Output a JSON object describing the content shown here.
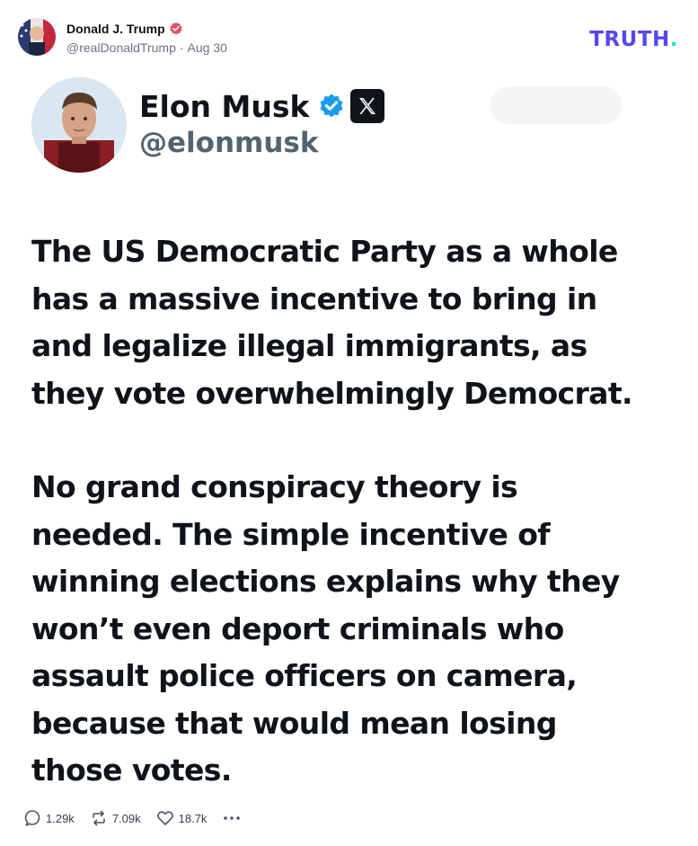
{
  "post": {
    "author_name": "Donald J. Trump",
    "handle": "@realDonaldTrump",
    "separator": "·",
    "date": "Aug 30"
  },
  "brand": {
    "logo_text": "TRUTH",
    "logo_dot": ".",
    "accent_color": "#5448ee",
    "dot_color": "#17e6c4"
  },
  "embedded_tweet": {
    "name": "Elon Musk",
    "handle": "@elonmusk",
    "paragraphs": [
      "The US Democratic Party as a whole\nhas a massive incentive to bring in\nand legalize illegal immigrants, as\nthey vote overwhelmingly Democrat.",
      "No grand conspiracy theory is\nneeded. The simple incentive of\nwinning elections explains why they\nwon’t even deport criminals who\nassault police officers on camera,\nbecause that would mean losing\nthose votes."
    ],
    "verified_color": "#1d9bf0"
  },
  "actions": {
    "replies": "1.29k",
    "retruths": "7.09k",
    "likes": "18.7k"
  },
  "icons": {
    "reply": "comment-icon",
    "retruth": "retruth-icon",
    "like": "heart-icon",
    "more": "more-icon",
    "verified": "verified-badge-icon",
    "x_logo": "x-logo-icon"
  }
}
